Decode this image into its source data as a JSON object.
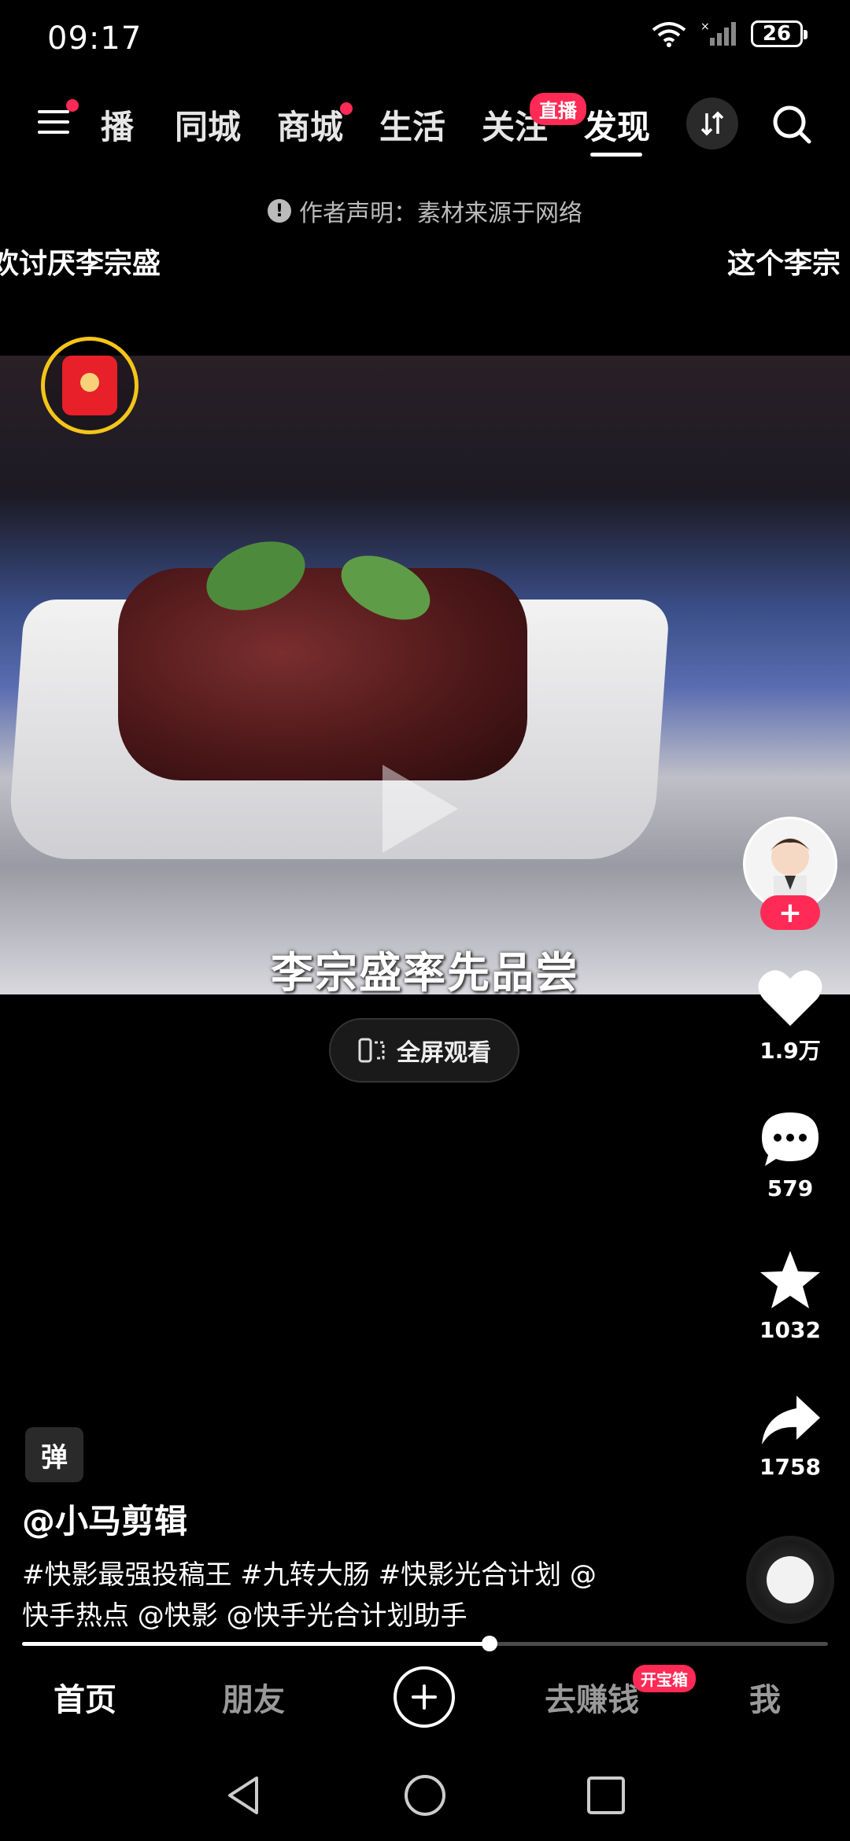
{
  "status_bar": {
    "time": "09:17",
    "battery": "26"
  },
  "top_nav": {
    "tabs": [
      "播",
      "同城",
      "商城",
      "生活",
      "关注",
      "发现"
    ],
    "active_tab": "发现",
    "live_badge": "直播",
    "icons": [
      "menu-icon",
      "switch-icon",
      "search-icon"
    ]
  },
  "notice": {
    "text": "作者声明：素材来源于网络"
  },
  "side_captions": {
    "left": "欢讨厌李宗盛",
    "right": "这个李宗"
  },
  "video": {
    "subtitle": "李宗盛率先品尝",
    "fullscreen_label": "全屏观看"
  },
  "actions": {
    "likes": "1.9万",
    "comments": "579",
    "favorites": "1032",
    "shares": "1758",
    "follow": "+"
  },
  "post": {
    "sticker": "弹",
    "author": "@小马剪辑",
    "description_line1": "#快影最强投稿王 #九转大肠 #快影光合计划 @",
    "description_line2": "快手热点 @快影 @快手光合计划助手",
    "progress": 0.58
  },
  "bottom_tabs": {
    "home": "首页",
    "friends": "朋友",
    "earn": "去赚钱",
    "earn_badge": "开宝箱",
    "me": "我"
  },
  "colors": {
    "accent": "#ff2a55",
    "gold": "#f5c518"
  }
}
